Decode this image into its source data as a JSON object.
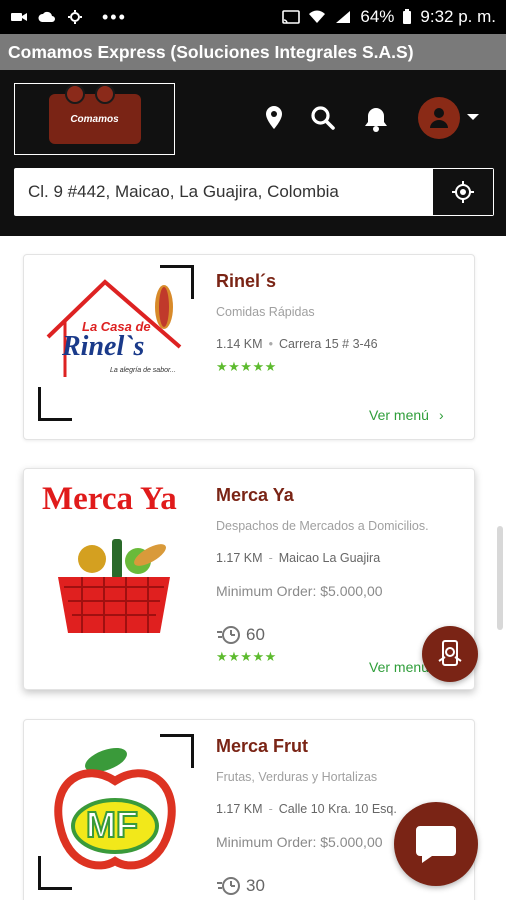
{
  "status_bar": {
    "battery": "64%",
    "time": "9:32 p. m."
  },
  "app": {
    "title": "Comamos Express (Soluciones Integrales S.A.S)"
  },
  "header": {
    "logo_text": "Comamos"
  },
  "address": {
    "value": "Cl. 9 #442, Maicao, La Guajira, Colombia"
  },
  "stores": [
    {
      "name": "Rinel´s",
      "category": "Comidas Rápidas",
      "distance": "1.14 KM",
      "address": "Carrera 15 # 3-46",
      "stars": "★★★★★",
      "rating": 5,
      "cta": "Ver menú",
      "logo_line1": "La Casa de",
      "logo_line2": "Rinel`s",
      "logo_line3": "La alegría de sabor..."
    },
    {
      "name": "Merca Ya",
      "category": "Despachos de Mercados a Domicilios.",
      "distance": "1.17 KM",
      "address": "Maicao La Guajira",
      "min_order": "Minimum Order: $5.000,00",
      "delivery_time": "60",
      "stars": "★★★★★",
      "rating": 5,
      "cta": "Ver menú",
      "logo_text": "Merca Ya"
    },
    {
      "name": "Merca Frut",
      "category": "Frutas, Verduras y Hortalizas",
      "distance": "1.17 KM",
      "address": "Calle 10 Kra. 10 Esq.",
      "min_order": "Minimum Order: $5.000,00",
      "delivery_time": "30",
      "logo_text": "MF"
    }
  ],
  "colors": {
    "brand": "#7a2415",
    "header_bg": "#101010",
    "titlebar_bg": "#7a7a7a",
    "star_green": "#5dbb2e",
    "link_green": "#2f9e3a"
  }
}
